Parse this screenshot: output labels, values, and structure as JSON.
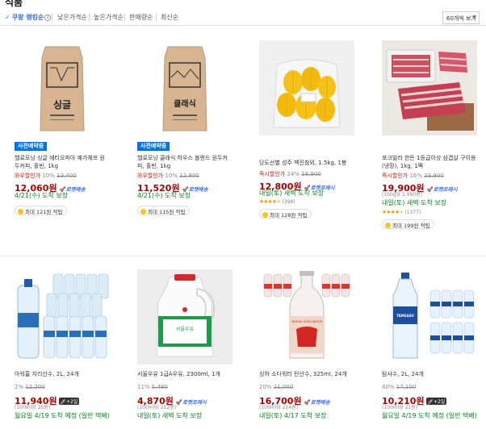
{
  "header": {
    "title_partial": "식품"
  },
  "sort": {
    "items": [
      "쿠팡 랭킹순",
      "낮은가격순",
      "높은가격순",
      "판매량순",
      "최신순"
    ],
    "per_page": "60개씩 보기"
  },
  "products": [
    {
      "badge": "사전예약중",
      "name": "헬로모닝 싱글 에티오피아 예가체프 원두커피, 홀빈, 1kg",
      "discount_label": "와우할인가",
      "discount_pct": "10%",
      "original_price": "13,400",
      "price": "12,060원",
      "rocket_label": "로켓배송",
      "delivery": "4/21(수) 도착 보장",
      "cashback": "최대 121원 적립"
    },
    {
      "badge": "사전예약중",
      "name": "헬로모닝 클래식 하우스 블렌드 원두커피, 홀빈, 1kg",
      "discount_label": "와우할인가",
      "discount_pct": "10%",
      "original_price": "12,800",
      "price": "11,520원",
      "rocket_label": "로켓배송",
      "delivery": "4/21(수) 도착 보장",
      "cashback": "최대 115원 적립"
    },
    {
      "name": "당도선별 성주 백진참외, 1.5kg, 1봉",
      "discount_label": "즉시할인가",
      "discount_pct": "24%",
      "original_price": "16,900",
      "price": "12,800원",
      "rocket_label": "로켓프레시",
      "delivery": "내일(토) 새벽 도착 보장",
      "review_count": "(398)",
      "rating": 4.5,
      "cashback": "최대 128원 적립"
    },
    {
      "name": "포크빌리 한돈 1등급이상 삼겹살 구이용 (냉장), 1kg, 1팩",
      "discount_label": "즉시할인가",
      "discount_pct": "16%",
      "original_price": "23,900",
      "price": "19,900원",
      "rocket_label": "로켓프레시",
      "unit_price": "(100g당 1,990원)",
      "delivery": "내일(토) 새벽 도착 보장",
      "review_count": "(1377)",
      "rating": 4.5,
      "cashback": "최대 199원 적립"
    },
    {
      "name": "아워홈 지리산수, 2L, 24개",
      "discount_pct": "2%",
      "original_price": "12,200",
      "price": "11,940원",
      "wow_label": "+2일",
      "unit_price": "(100ml당 25원)",
      "delivery": "월요일 4/19 도착 예정 (일반 택배)"
    },
    {
      "name": "서울우유 1급A우유, 2300ml, 1개",
      "discount_pct": "11%",
      "original_price": "5,480",
      "price": "4,870원",
      "rocket_label": "로켓프레시",
      "unit_price": "(100ml당 212원)",
      "delivery": "내일(토) 새벽 도착 보장"
    },
    {
      "name": "싱하 소다워터 탄산수, 325ml, 24개",
      "discount_pct": "20%",
      "original_price": "21,000",
      "price": "16,700원",
      "rocket_label": "로켓배송",
      "unit_price": "(100ml당 214원)",
      "delivery": "내일(토) 4/17 도착 보장"
    },
    {
      "name": "탐사수, 2L, 24개",
      "discount_pct": "40%",
      "original_price": "17,100",
      "price": "10,210원",
      "wow_label": "+2일",
      "unit_price": "(100ml당 21원)",
      "delivery": "월요일 4/19 도착 예정 (일반 택배)"
    }
  ],
  "images": {
    "bag1_text": "싱글",
    "bag2_text": "클래식",
    "bottle_label": "TAMSASU",
    "milk_label": "서울우유",
    "soda_label": "SINGHA SODA WATER"
  },
  "colors": {
    "accent_blue": "#346aff",
    "price_red": "#ae0000",
    "badge_blue": "#0073e9",
    "delivery_green": "#00891a",
    "star_orange": "#ff9600"
  }
}
